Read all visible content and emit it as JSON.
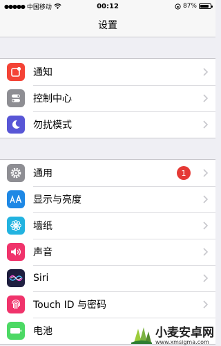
{
  "status": {
    "carrier": "中国移动",
    "time": "00:12",
    "battery_percent": "87%",
    "battery_level": 0.87
  },
  "nav": {
    "title": "设置"
  },
  "groups": [
    {
      "items": [
        {
          "label": "通知",
          "icon": "notifications-icon",
          "color": "#f44336"
        },
        {
          "label": "控制中心",
          "icon": "control-center-icon",
          "color": "#8e8e93"
        },
        {
          "label": "勿扰模式",
          "icon": "moon-icon",
          "color": "#5856d6"
        }
      ]
    },
    {
      "items": [
        {
          "label": "通用",
          "icon": "gear-icon",
          "color": "#8e8e93",
          "badge": "1"
        },
        {
          "label": "显示与亮度",
          "icon": "display-brightness-icon",
          "color": "#1e88e5"
        },
        {
          "label": "墙纸",
          "icon": "wallpaper-flower-icon",
          "color": "#22b3e0"
        },
        {
          "label": "声音",
          "icon": "speaker-icon",
          "color": "#f0336b"
        },
        {
          "label": "Siri",
          "icon": "siri-icon",
          "color": "#222244"
        },
        {
          "label": "Touch ID 与密码",
          "icon": "fingerprint-icon",
          "color": "#f0336b"
        },
        {
          "label": "电池",
          "icon": "battery-icon",
          "color": "#4cd964"
        }
      ]
    }
  ],
  "watermark": {
    "title": "小麦安卓网",
    "url": "www.xmsigma.com"
  },
  "colors": {
    "chevron": "#c7c7cc",
    "badge": "#e53935",
    "background": "#efeff4"
  }
}
